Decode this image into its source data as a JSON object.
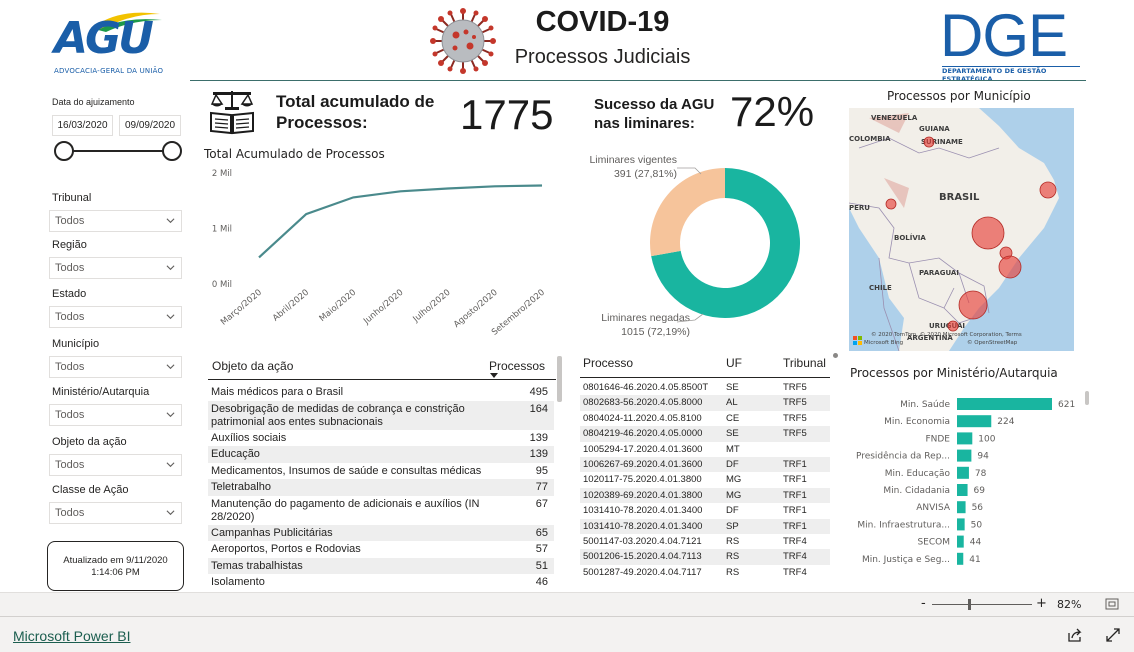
{
  "header": {
    "agu_logo_text": "AGU",
    "agu_subtitle": "ADVOCACIA-GERAL DA UNIÃO",
    "title": "COVID-19",
    "subtitle": "Processos Judiciais",
    "dge_logo_text": "DGE",
    "dge_subtitle": "DEPARTAMENTO DE GESTÃO ESTRATÉGICA"
  },
  "filters": {
    "date_label": "Data do ajuizamento",
    "date_start": "16/03/2020",
    "date_end": "09/09/2020",
    "slicers": [
      {
        "label": "Tribunal",
        "value": "Todos"
      },
      {
        "label": "Região",
        "value": "Todos"
      },
      {
        "label": "Estado",
        "value": "Todos"
      },
      {
        "label": "Município",
        "value": "Todos"
      },
      {
        "label": "Ministério/Autarquia",
        "value": "Todos"
      },
      {
        "label": "Objeto da ação",
        "value": "Todos"
      },
      {
        "label": "Classe de Ação",
        "value": "Todos"
      }
    ],
    "updated_line1": "Atualizado em 9/11/2020",
    "updated_line2": "1:14:06 PM"
  },
  "kpi": {
    "total_label_1": "Total acumulado de",
    "total_label_2": "Processos:",
    "total_value": "1775",
    "success_label_1": "Sucesso da AGU",
    "success_label_2": "nas liminares:",
    "success_value": "72%"
  },
  "line_chart": {
    "title": "Total Acumulado de Processos",
    "y_ticks": [
      "2 Mil",
      "1 Mil",
      "0 Mil"
    ]
  },
  "donut": {
    "vigentes_label": "Liminares vigentes",
    "vigentes_value": "391 (27,81%)",
    "negadas_label": "Liminares negadas",
    "negadas_value": "1015 (72,19%)",
    "colors": {
      "negadas": "#19b5a0",
      "vigentes": "#f6c49b"
    }
  },
  "map": {
    "title": "Processos por Município",
    "labels": [
      "VENEZUELA",
      "GUIANA",
      "COLOMBIA",
      "SURINAME",
      "BRASIL",
      "PERU",
      "BOLÍVIA",
      "PARAGUAI",
      "CHILE",
      "URUGUAI",
      "ARGENTINA"
    ],
    "copyright": "© 2020 TomTom, © 2020 Microsoft Corporation, Terms",
    "osm": "© OpenStreetMap",
    "ms_label": "Microsoft Bing"
  },
  "table_objeto": {
    "col1": "Objeto da ação",
    "col2": "Processos",
    "rows": [
      {
        "name": "Mais médicos para o Brasil",
        "value": "495"
      },
      {
        "name": "Desobrigação de medidas de cobrança e constrição patrimonial aos entes subnacionais",
        "value": "164"
      },
      {
        "name": "Auxílios sociais",
        "value": "139"
      },
      {
        "name": "Educação",
        "value": "139"
      },
      {
        "name": "Medicamentos, Insumos de saúde e consultas médicas",
        "value": "95"
      },
      {
        "name": "Teletrabalho",
        "value": "77"
      },
      {
        "name": "Manutenção do pagamento de adicionais e auxílios (IN 28/2020)",
        "value": "67"
      },
      {
        "name": "Campanhas Publicitárias",
        "value": "65"
      },
      {
        "name": "Aeroportos, Portos e Rodovias",
        "value": "57"
      },
      {
        "name": "Temas trabalhistas",
        "value": "51"
      },
      {
        "name": "Isolamento",
        "value": "46"
      }
    ]
  },
  "table_processo": {
    "col1": "Processo",
    "col2": "UF",
    "col3": "Tribunal",
    "rows": [
      {
        "p": "0801646-46.2020.4.05.8500T",
        "uf": "SE",
        "t": "TRF5"
      },
      {
        "p": "0802683-56.2020.4.05.8000",
        "uf": "AL",
        "t": "TRF5"
      },
      {
        "p": "0804024-11.2020.4.05.8100",
        "uf": "CE",
        "t": "TRF5"
      },
      {
        "p": "0804219-46.2020.4.05.0000",
        "uf": "SE",
        "t": "TRF5"
      },
      {
        "p": "1005294-17.2020.4.01.3600",
        "uf": "MT",
        "t": ""
      },
      {
        "p": "1006267-69.2020.4.01.3600",
        "uf": "DF",
        "t": "TRF1"
      },
      {
        "p": "1020117-75.2020.4.01.3800",
        "uf": "MG",
        "t": "TRF1"
      },
      {
        "p": "1020389-69.2020.4.01.3800",
        "uf": "MG",
        "t": "TRF1"
      },
      {
        "p": "1031410-78.2020.4.01.3400",
        "uf": "DF",
        "t": "TRF1"
      },
      {
        "p": "1031410-78.2020.4.01.3400",
        "uf": "SP",
        "t": "TRF1"
      },
      {
        "p": "5001147-03.2020.4.04.7121",
        "uf": "RS",
        "t": "TRF4"
      },
      {
        "p": "5001206-15.2020.4.04.7113",
        "uf": "RS",
        "t": "TRF4"
      },
      {
        "p": "5001287-49.2020.4.04.7117",
        "uf": "RS",
        "t": "TRF4"
      }
    ]
  },
  "bar_chart": {
    "title": "Processos por Ministério/Autarquia",
    "bar_color": "#19b5a0"
  },
  "chart_data": [
    {
      "type": "line",
      "title": "Total Acumulado de Processos",
      "x": [
        "Março/2020",
        "Abril/2020",
        "Maio/2020",
        "Junho/2020",
        "Julho/2020",
        "Agosto/2020",
        "Setembro/2020"
      ],
      "values": [
        480,
        1260,
        1560,
        1670,
        1720,
        1760,
        1775
      ],
      "ylim": [
        0,
        2000
      ],
      "y_tick_labels": [
        "0 Mil",
        "1 Mil",
        "2 Mil"
      ],
      "color": "#4a8a8c"
    },
    {
      "type": "pie",
      "categories": [
        "Liminares negadas",
        "Liminares vigentes"
      ],
      "values": [
        1015,
        391
      ],
      "percent_labels": [
        "72,19%",
        "27,81%"
      ]
    },
    {
      "type": "bar",
      "title": "Processos por Ministério/Autarquia",
      "categories": [
        "Min. Saúde",
        "Min. Economia",
        "FNDE",
        "Presidência da Rep...",
        "Min. Educação",
        "Min. Cidadania",
        "ANVISA",
        "Min. Infraestrutura...",
        "SECOM",
        "Min. Justiça e Seg..."
      ],
      "values": [
        621,
        224,
        100,
        94,
        78,
        69,
        56,
        50,
        44,
        41
      ]
    }
  ],
  "zoom": {
    "minus": "-",
    "plus": "+",
    "level": "82%"
  },
  "footer": {
    "link": "Microsoft Power BI"
  }
}
